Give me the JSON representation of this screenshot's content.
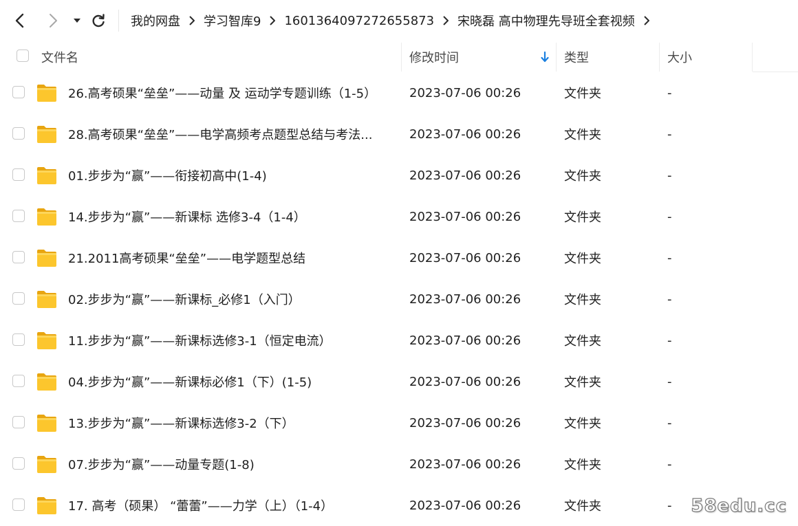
{
  "nav": {
    "back_icon": "chevron-left-icon",
    "forward_icon": "chevron-right-icon",
    "dropdown_icon": "caret-down-icon",
    "refresh_icon": "refresh-icon"
  },
  "breadcrumb": [
    "我的网盘",
    "学习智库9",
    "1601364097272655873",
    "宋晓磊 高中物理先导班全套视频"
  ],
  "columns": {
    "name": "文件名",
    "modified": "修改时间",
    "type": "类型",
    "size": "大小"
  },
  "sort": {
    "column": "修改时间",
    "direction": "descending",
    "color": "#1a7fe0"
  },
  "folder_color": "#f9c623",
  "rows": [
    {
      "name": "26.高考硕果“垒垒”——动量 及 运动学专题训练（1-5）",
      "modified": "2023-07-06 00:26",
      "type": "文件夹",
      "size": "-"
    },
    {
      "name": "28.高考硕果“垒垒”——电学高频考点题型总结与考法...",
      "modified": "2023-07-06 00:26",
      "type": "文件夹",
      "size": "-"
    },
    {
      "name": "01.步步为“赢”——衔接初高中(1-4)",
      "modified": "2023-07-06 00:26",
      "type": "文件夹",
      "size": "-"
    },
    {
      "name": "14.步步为“赢”——新课标 选修3-4（1-4）",
      "modified": "2023-07-06 00:26",
      "type": "文件夹",
      "size": "-"
    },
    {
      "name": "21.2011高考硕果“垒垒”——电学题型总结",
      "modified": "2023-07-06 00:26",
      "type": "文件夹",
      "size": "-"
    },
    {
      "name": "02.步步为“赢”——新课标_必修1（入门）",
      "modified": "2023-07-06 00:26",
      "type": "文件夹",
      "size": "-"
    },
    {
      "name": "11.步步为“赢”——新课标选修3-1（恒定电流）",
      "modified": "2023-07-06 00:26",
      "type": "文件夹",
      "size": "-"
    },
    {
      "name": "04.步步为“赢”——新课标必修1（下）(1-5)",
      "modified": "2023-07-06 00:26",
      "type": "文件夹",
      "size": "-"
    },
    {
      "name": "13.步步为“赢”——新课标选修3-2（下）",
      "modified": "2023-07-06 00:26",
      "type": "文件夹",
      "size": "-"
    },
    {
      "name": "07.步步为“赢”——动量专题(1-8)",
      "modified": "2023-07-06 00:26",
      "type": "文件夹",
      "size": "-"
    },
    {
      "name": "17. 高考（硕果） “蕾蕾”——力学（上）（1-4）",
      "modified": "2023-07-06 00:26",
      "type": "文件夹",
      "size": "-"
    }
  ],
  "watermark": "58edu.cc"
}
